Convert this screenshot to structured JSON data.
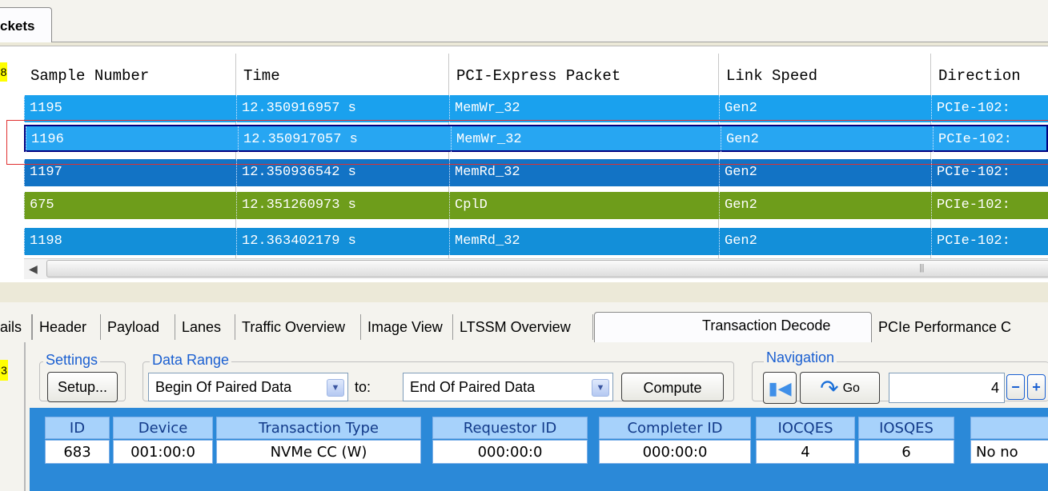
{
  "top_tab": {
    "label": "ckets"
  },
  "grid": {
    "headers": [
      "Sample Number",
      "Time",
      "PCI-Express Packet",
      "Link Speed",
      "Direction"
    ],
    "rows": [
      {
        "sample": "1195",
        "time": "12.350916957 s",
        "packet": "MemWr_32",
        "speed": "Gen2",
        "direction": "PCIe-102:",
        "color": "#1aa1ee"
      },
      {
        "sample": "1196",
        "time": "12.350917057 s",
        "packet": "MemWr_32",
        "speed": "Gen2",
        "direction": "PCIe-102:",
        "color": "#27a6f2"
      },
      {
        "sample": "1197",
        "time": "12.350936542 s",
        "packet": "MemRd_32",
        "speed": "Gen2",
        "direction": "PCIe-102:",
        "color": "#1273c5"
      },
      {
        "sample": "675",
        "time": "12.351260973 s",
        "packet": "CplD",
        "speed": "Gen2",
        "direction": "PCIe-102:",
        "color": "#6e9d1b"
      },
      {
        "sample": "1198",
        "time": "12.363402179 s",
        "packet": "MemRd_32",
        "speed": "Gen2",
        "direction": "PCIe-102:",
        "color": "#138fd9"
      }
    ],
    "row_marker": "8"
  },
  "bottom_tabs": [
    "ails",
    "Header",
    "Payload",
    "Lanes",
    "Traffic Overview",
    "Image View",
    "LTSSM Overview",
    "Transaction Decode",
    "PCIe Performance C"
  ],
  "active_tab": "Transaction Decode",
  "panel": {
    "marker": "3",
    "settings": {
      "label": "Settings",
      "setup_button": "Setup..."
    },
    "data_range": {
      "label": "Data Range",
      "from": "Begin Of Paired Data",
      "to_label": "to:",
      "to": "End Of Paired Data",
      "compute_button": "Compute"
    },
    "navigation": {
      "label": "Navigation",
      "go_button": "Go",
      "value": "4",
      "minus": "−",
      "plus": "+"
    }
  },
  "decode_table": {
    "headers": [
      "ID",
      "Device",
      "Transaction Type",
      "Requestor ID",
      "Completer ID",
      "IOCQES",
      "IOSQES",
      ""
    ],
    "values": [
      "683",
      "001:00:0",
      "NVMe CC (W)",
      "000:00:0",
      "000:00:0",
      "4",
      "6",
      "No no"
    ]
  },
  "colors": {
    "accent": "#1a5fd1",
    "row_blue": "#1aa1ee",
    "row_green": "#6e9d1b",
    "header_cell": "#a7d2fb"
  }
}
